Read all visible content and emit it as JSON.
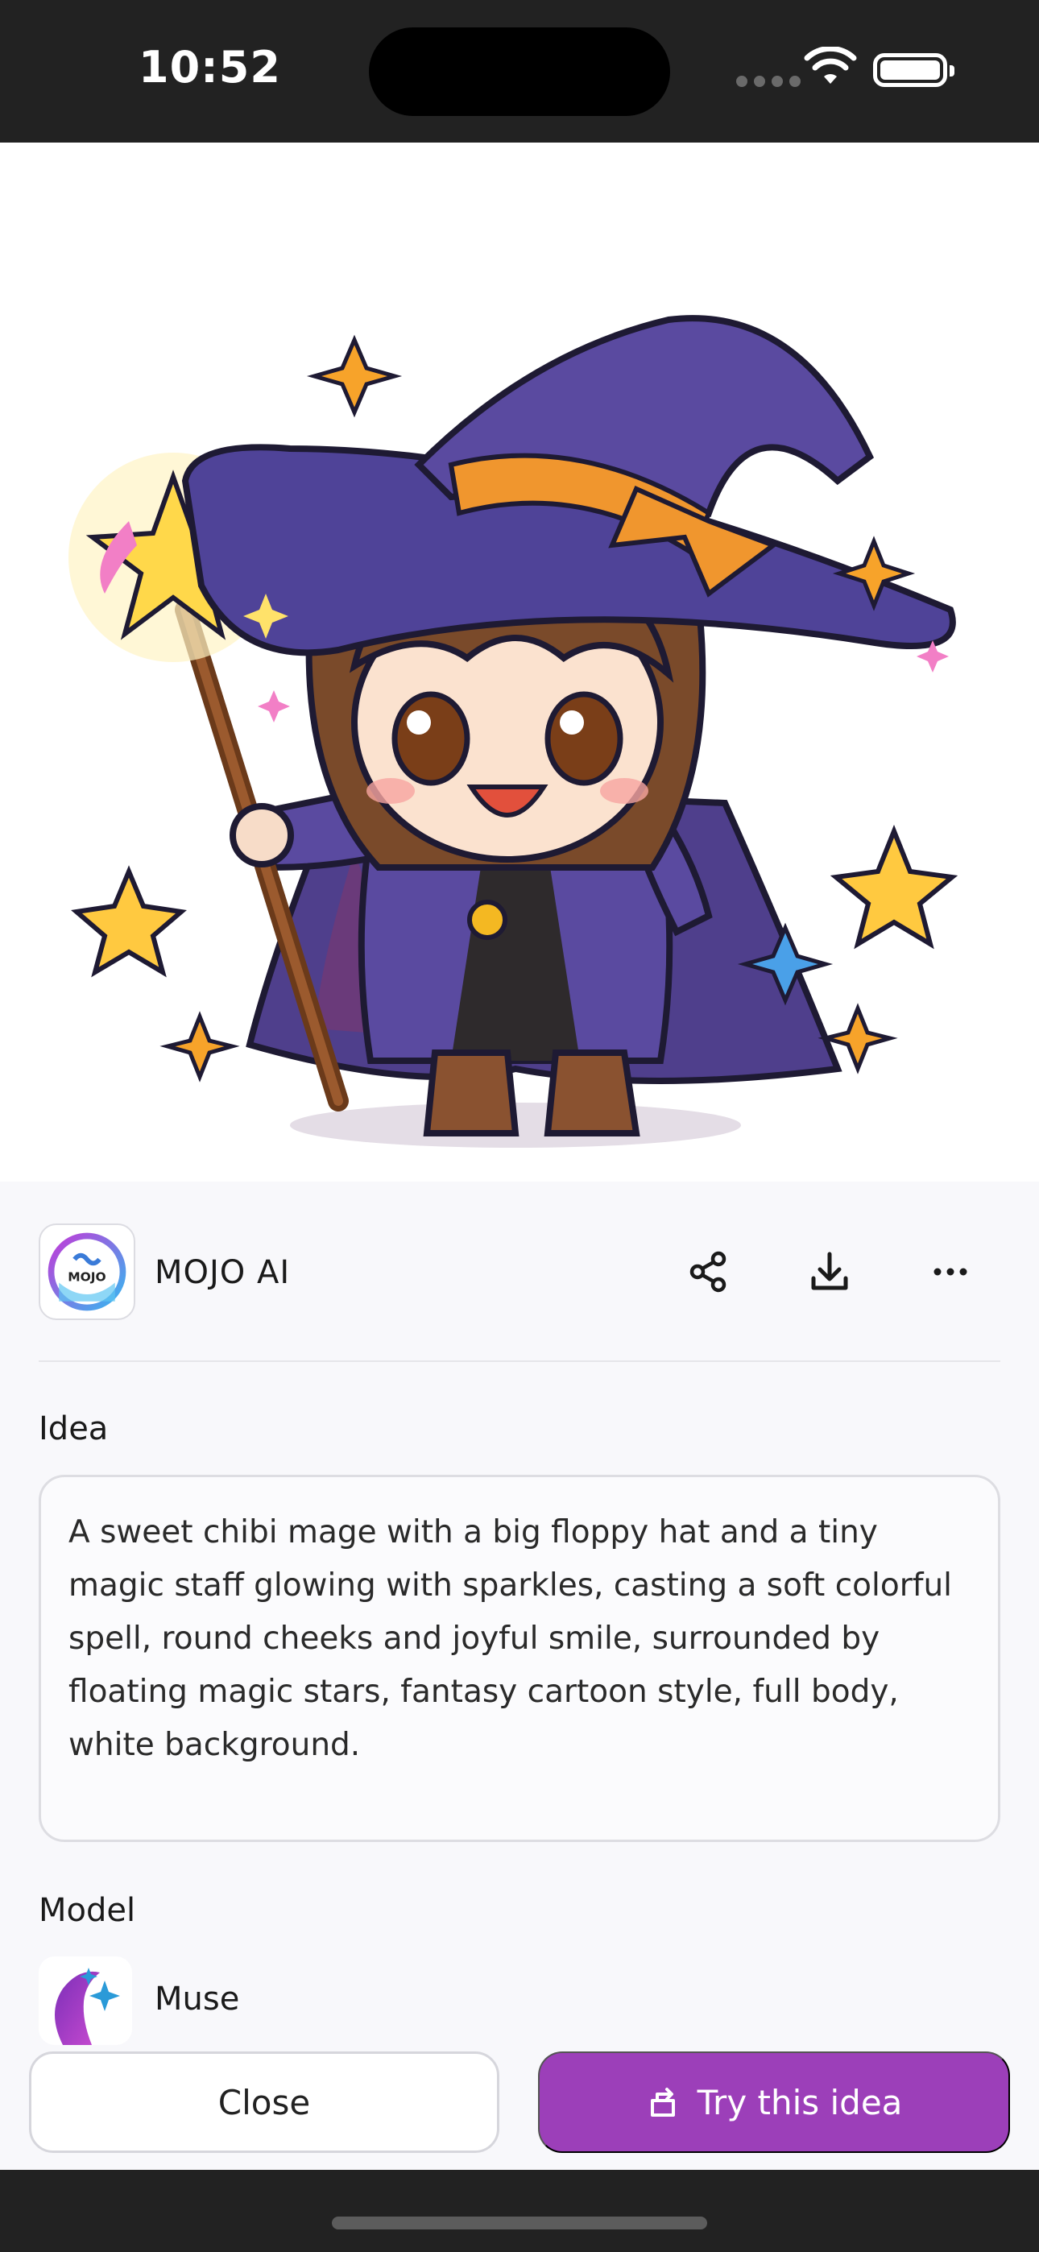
{
  "status_bar": {
    "time": "10:52"
  },
  "author": {
    "name": "MOJO AI",
    "logo_text": "MOJO"
  },
  "actions": {
    "share": "share-icon",
    "download": "download-icon",
    "more": "more-icon"
  },
  "idea": {
    "label": "Idea",
    "text": "A sweet chibi mage with a big floppy hat and a tiny magic staff glowing with sparkles, casting a soft colorful spell, round cheeks and joyful smile, surrounded by floating magic stars, fantasy cartoon style, full body, white background."
  },
  "model": {
    "label": "Model",
    "name": "Muse"
  },
  "buttons": {
    "close": "Close",
    "try": "Try this idea"
  },
  "colors": {
    "accent": "#9c3fb9",
    "background": "#f8f8fb",
    "status_bar": "#222222"
  }
}
